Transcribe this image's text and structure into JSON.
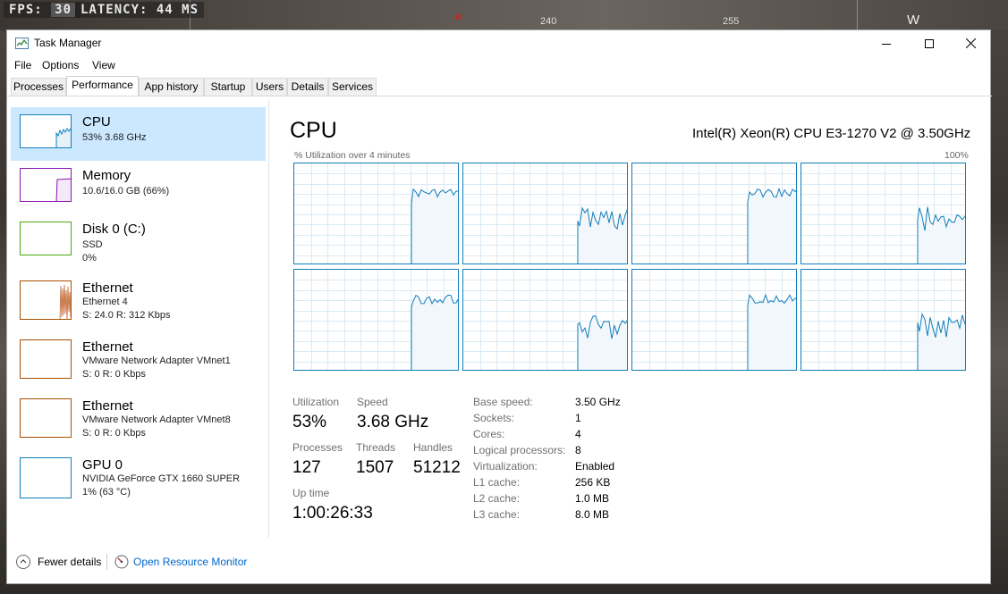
{
  "hud": {
    "fps_label": "FPS:",
    "fps_value": "30",
    "latency_label": "LATENCY:",
    "latency_value": "44 MS",
    "compass": [
      "240",
      "255"
    ],
    "compass_dir": "W"
  },
  "window": {
    "title": "Task Manager"
  },
  "menu": [
    "File",
    "Options",
    "View"
  ],
  "tabs": [
    "Processes",
    "Performance",
    "App history",
    "Startup",
    "Users",
    "Details",
    "Services"
  ],
  "active_tab": "Performance",
  "sidebar": [
    {
      "title": "CPU",
      "lines": [
        "53%  3.68 GHz"
      ],
      "color": "#117dbb",
      "selected": true
    },
    {
      "title": "Memory",
      "lines": [
        "10.6/16.0 GB (66%)"
      ],
      "color": "#8b12ae"
    },
    {
      "title": "Disk 0 (C:)",
      "lines": [
        "SSD",
        "0%"
      ],
      "color": "#4da60c"
    },
    {
      "title": "Ethernet",
      "lines": [
        "Ethernet 4",
        "S: 24.0  R: 312 Kbps"
      ],
      "color": "#a74f01"
    },
    {
      "title": "Ethernet",
      "lines": [
        "VMware Network Adapter VMnet1",
        "S: 0  R: 0 Kbps"
      ],
      "color": "#a74f01"
    },
    {
      "title": "Ethernet",
      "lines": [
        "VMware Network Adapter VMnet8",
        "S: 0  R: 0 Kbps"
      ],
      "color": "#a74f01"
    },
    {
      "title": "GPU 0",
      "lines": [
        "NVIDIA GeForce GTX 1660 SUPER",
        "1% (63 °C)"
      ],
      "color": "#117dbb"
    }
  ],
  "main": {
    "title": "CPU",
    "model": "Intel(R) Xeon(R) CPU E3-1270 V2 @ 3.50GHz",
    "util_label": "% Utilization over 4 minutes",
    "util_max": "100%",
    "graph_color": "#117dbb"
  },
  "stats": {
    "utilization_label": "Utilization",
    "utilization": "53%",
    "speed_label": "Speed",
    "speed": "3.68 GHz",
    "processes_label": "Processes",
    "processes": "127",
    "threads_label": "Threads",
    "threads": "1507",
    "handles_label": "Handles",
    "handles": "51212",
    "uptime_label": "Up time",
    "uptime": "1:00:26:33"
  },
  "specs": [
    {
      "label": "Base speed:",
      "value": "3.50 GHz"
    },
    {
      "label": "Sockets:",
      "value": "1"
    },
    {
      "label": "Cores:",
      "value": "4"
    },
    {
      "label": "Logical processors:",
      "value": "8"
    },
    {
      "label": "Virtualization:",
      "value": "Enabled"
    },
    {
      "label": "L1 cache:",
      "value": "256 KB"
    },
    {
      "label": "L2 cache:",
      "value": "1.0 MB"
    },
    {
      "label": "L3 cache:",
      "value": "8.0 MB"
    }
  ],
  "footer": {
    "fewer_details": "Fewer details",
    "resource_monitor": "Open Resource Monitor"
  }
}
